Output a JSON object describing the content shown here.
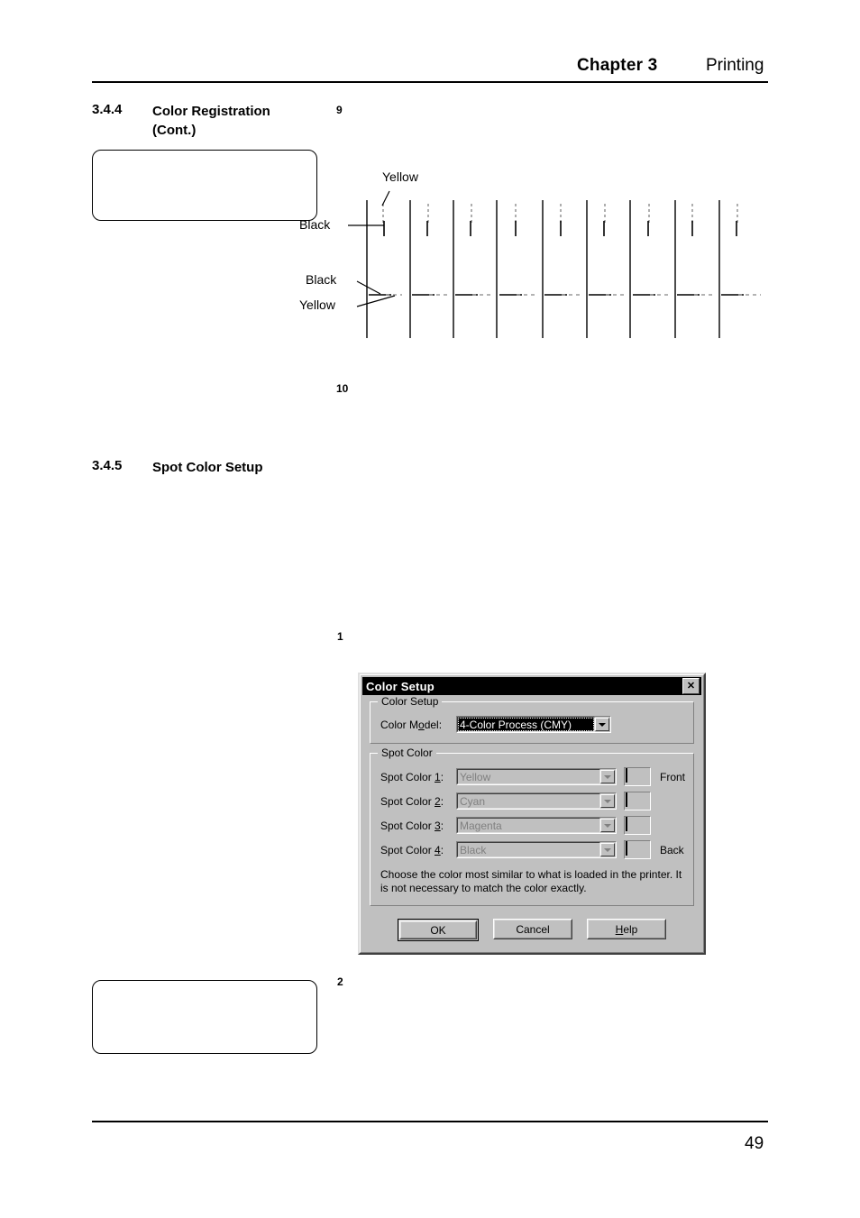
{
  "header": {
    "chapter": "Chapter 3",
    "section": "Printing"
  },
  "footer": {
    "page_number": "49"
  },
  "sections": [
    {
      "number": "3.4.4",
      "title": "Color Registration\n(Cont.)"
    },
    {
      "number": "3.4.5",
      "title": "Spot Color Setup"
    }
  ],
  "steps": {
    "step9": "9",
    "step10": "10",
    "step1": "1",
    "step2": "2"
  },
  "diagram": {
    "labels": {
      "yellow_top": "Yellow",
      "black_top": "Black",
      "black_bottom": "Black",
      "yellow_bottom": "Yellow"
    },
    "columns": 9,
    "colors": {
      "black_line": "#000000",
      "yellow_line": "#9a9a9a"
    }
  },
  "dialog": {
    "title": "Color Setup",
    "close_label": "✕",
    "color_setup_group": {
      "legend": "Color Setup",
      "color_model_label_pre": "Color M",
      "color_model_label_accel": "o",
      "color_model_label_post": "del:",
      "color_model_value": "4-Color Process (CMY)"
    },
    "spot_color_group": {
      "legend": "Spot Color",
      "rows": [
        {
          "label_pre": "Spot Color ",
          "label_accel": "1",
          "label_post": ":",
          "value": "Yellow",
          "swatch": "#f7f7f5",
          "side": "Front"
        },
        {
          "label_pre": "Spot Color ",
          "label_accel": "2",
          "label_post": ":",
          "value": "Cyan",
          "swatch": "#dcdcdc",
          "side": ""
        },
        {
          "label_pre": "Spot Color ",
          "label_accel": "3",
          "label_post": ":",
          "value": "Magenta",
          "swatch": "#8f8f8f",
          "side": ""
        },
        {
          "label_pre": "Spot Color ",
          "label_accel": "4",
          "label_post": ":",
          "value": "Black",
          "swatch": "#000000",
          "side": "Back"
        }
      ],
      "help_text": "Choose the color most similar to what is loaded in the printer.  It is not necessary to match the color exactly."
    },
    "buttons": {
      "ok": "OK",
      "cancel": "Cancel",
      "help_pre": "",
      "help_accel": "H",
      "help_post": "elp"
    }
  }
}
